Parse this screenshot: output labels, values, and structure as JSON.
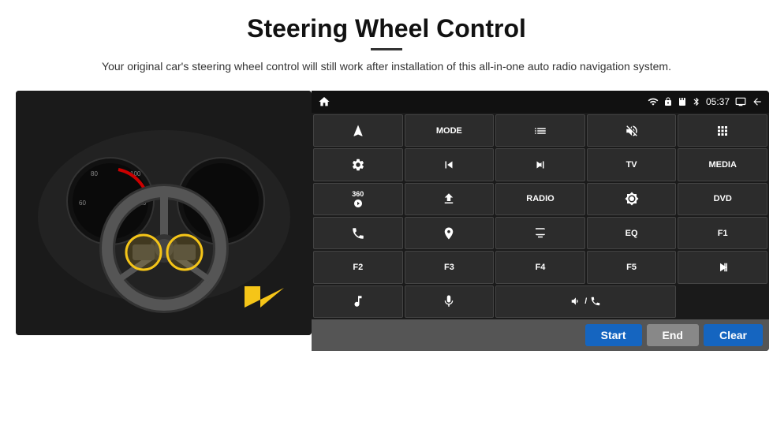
{
  "header": {
    "title": "Steering Wheel Control",
    "subtitle": "Your original car's steering wheel control will still work after installation of this all-in-one auto radio navigation system."
  },
  "status_bar": {
    "time": "05:37",
    "icons": [
      "wifi",
      "lock",
      "sd",
      "bt",
      "screen",
      "back"
    ]
  },
  "grid_buttons": [
    {
      "id": "row1",
      "buttons": [
        {
          "label": "",
          "icon": "nav",
          "type": "icon"
        },
        {
          "label": "MODE",
          "icon": "",
          "type": "text"
        },
        {
          "label": "",
          "icon": "menu",
          "type": "icon"
        },
        {
          "label": "",
          "icon": "mute",
          "type": "icon"
        },
        {
          "label": "",
          "icon": "apps",
          "type": "icon"
        }
      ]
    },
    {
      "id": "row2",
      "buttons": [
        {
          "label": "",
          "icon": "settings",
          "type": "icon"
        },
        {
          "label": "",
          "icon": "prev",
          "type": "icon"
        },
        {
          "label": "",
          "icon": "next",
          "type": "icon"
        },
        {
          "label": "TV",
          "type": "text"
        },
        {
          "label": "MEDIA",
          "type": "text"
        }
      ]
    },
    {
      "id": "row3",
      "buttons": [
        {
          "label": "360",
          "type": "text"
        },
        {
          "label": "",
          "icon": "eject",
          "type": "icon"
        },
        {
          "label": "RADIO",
          "type": "text"
        },
        {
          "label": "",
          "icon": "brightness",
          "type": "icon"
        },
        {
          "label": "DVD",
          "type": "text"
        }
      ]
    },
    {
      "id": "row4",
      "buttons": [
        {
          "label": "",
          "icon": "phone",
          "type": "icon"
        },
        {
          "label": "",
          "icon": "gps",
          "type": "icon"
        },
        {
          "label": "",
          "icon": "display",
          "type": "icon"
        },
        {
          "label": "EQ",
          "type": "text"
        },
        {
          "label": "F1",
          "type": "text"
        }
      ]
    },
    {
      "id": "row5",
      "buttons": [
        {
          "label": "F2",
          "type": "text"
        },
        {
          "label": "F3",
          "type": "text"
        },
        {
          "label": "F4",
          "type": "text"
        },
        {
          "label": "F5",
          "type": "text"
        },
        {
          "label": "",
          "icon": "play-pause",
          "type": "icon"
        }
      ]
    },
    {
      "id": "row6",
      "buttons": [
        {
          "label": "",
          "icon": "music",
          "type": "icon"
        },
        {
          "label": "",
          "icon": "mic",
          "type": "icon"
        },
        {
          "label": "",
          "icon": "vol-phone",
          "type": "icon",
          "wide": true
        }
      ]
    }
  ],
  "action_buttons": {
    "start_label": "Start",
    "end_label": "End",
    "clear_label": "Clear"
  }
}
